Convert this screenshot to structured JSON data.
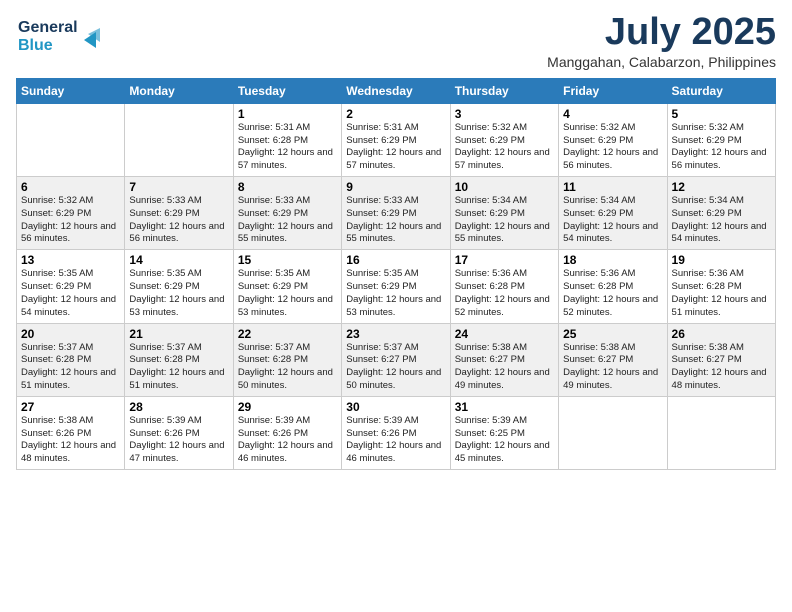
{
  "logo": {
    "line1": "General",
    "line2": "Blue"
  },
  "header": {
    "title": "July 2025",
    "subtitle": "Manggahan, Calabarzon, Philippines"
  },
  "days_of_week": [
    "Sunday",
    "Monday",
    "Tuesday",
    "Wednesday",
    "Thursday",
    "Friday",
    "Saturday"
  ],
  "weeks": [
    [
      {
        "day": "",
        "info": ""
      },
      {
        "day": "",
        "info": ""
      },
      {
        "day": "1",
        "info": "Sunrise: 5:31 AM\nSunset: 6:28 PM\nDaylight: 12 hours and 57 minutes."
      },
      {
        "day": "2",
        "info": "Sunrise: 5:31 AM\nSunset: 6:29 PM\nDaylight: 12 hours and 57 minutes."
      },
      {
        "day": "3",
        "info": "Sunrise: 5:32 AM\nSunset: 6:29 PM\nDaylight: 12 hours and 57 minutes."
      },
      {
        "day": "4",
        "info": "Sunrise: 5:32 AM\nSunset: 6:29 PM\nDaylight: 12 hours and 56 minutes."
      },
      {
        "day": "5",
        "info": "Sunrise: 5:32 AM\nSunset: 6:29 PM\nDaylight: 12 hours and 56 minutes."
      }
    ],
    [
      {
        "day": "6",
        "info": "Sunrise: 5:32 AM\nSunset: 6:29 PM\nDaylight: 12 hours and 56 minutes."
      },
      {
        "day": "7",
        "info": "Sunrise: 5:33 AM\nSunset: 6:29 PM\nDaylight: 12 hours and 56 minutes."
      },
      {
        "day": "8",
        "info": "Sunrise: 5:33 AM\nSunset: 6:29 PM\nDaylight: 12 hours and 55 minutes."
      },
      {
        "day": "9",
        "info": "Sunrise: 5:33 AM\nSunset: 6:29 PM\nDaylight: 12 hours and 55 minutes."
      },
      {
        "day": "10",
        "info": "Sunrise: 5:34 AM\nSunset: 6:29 PM\nDaylight: 12 hours and 55 minutes."
      },
      {
        "day": "11",
        "info": "Sunrise: 5:34 AM\nSunset: 6:29 PM\nDaylight: 12 hours and 54 minutes."
      },
      {
        "day": "12",
        "info": "Sunrise: 5:34 AM\nSunset: 6:29 PM\nDaylight: 12 hours and 54 minutes."
      }
    ],
    [
      {
        "day": "13",
        "info": "Sunrise: 5:35 AM\nSunset: 6:29 PM\nDaylight: 12 hours and 54 minutes."
      },
      {
        "day": "14",
        "info": "Sunrise: 5:35 AM\nSunset: 6:29 PM\nDaylight: 12 hours and 53 minutes."
      },
      {
        "day": "15",
        "info": "Sunrise: 5:35 AM\nSunset: 6:29 PM\nDaylight: 12 hours and 53 minutes."
      },
      {
        "day": "16",
        "info": "Sunrise: 5:35 AM\nSunset: 6:29 PM\nDaylight: 12 hours and 53 minutes."
      },
      {
        "day": "17",
        "info": "Sunrise: 5:36 AM\nSunset: 6:28 PM\nDaylight: 12 hours and 52 minutes."
      },
      {
        "day": "18",
        "info": "Sunrise: 5:36 AM\nSunset: 6:28 PM\nDaylight: 12 hours and 52 minutes."
      },
      {
        "day": "19",
        "info": "Sunrise: 5:36 AM\nSunset: 6:28 PM\nDaylight: 12 hours and 51 minutes."
      }
    ],
    [
      {
        "day": "20",
        "info": "Sunrise: 5:37 AM\nSunset: 6:28 PM\nDaylight: 12 hours and 51 minutes."
      },
      {
        "day": "21",
        "info": "Sunrise: 5:37 AM\nSunset: 6:28 PM\nDaylight: 12 hours and 51 minutes."
      },
      {
        "day": "22",
        "info": "Sunrise: 5:37 AM\nSunset: 6:28 PM\nDaylight: 12 hours and 50 minutes."
      },
      {
        "day": "23",
        "info": "Sunrise: 5:37 AM\nSunset: 6:27 PM\nDaylight: 12 hours and 50 minutes."
      },
      {
        "day": "24",
        "info": "Sunrise: 5:38 AM\nSunset: 6:27 PM\nDaylight: 12 hours and 49 minutes."
      },
      {
        "day": "25",
        "info": "Sunrise: 5:38 AM\nSunset: 6:27 PM\nDaylight: 12 hours and 49 minutes."
      },
      {
        "day": "26",
        "info": "Sunrise: 5:38 AM\nSunset: 6:27 PM\nDaylight: 12 hours and 48 minutes."
      }
    ],
    [
      {
        "day": "27",
        "info": "Sunrise: 5:38 AM\nSunset: 6:26 PM\nDaylight: 12 hours and 48 minutes."
      },
      {
        "day": "28",
        "info": "Sunrise: 5:39 AM\nSunset: 6:26 PM\nDaylight: 12 hours and 47 minutes."
      },
      {
        "day": "29",
        "info": "Sunrise: 5:39 AM\nSunset: 6:26 PM\nDaylight: 12 hours and 46 minutes."
      },
      {
        "day": "30",
        "info": "Sunrise: 5:39 AM\nSunset: 6:26 PM\nDaylight: 12 hours and 46 minutes."
      },
      {
        "day": "31",
        "info": "Sunrise: 5:39 AM\nSunset: 6:25 PM\nDaylight: 12 hours and 45 minutes."
      },
      {
        "day": "",
        "info": ""
      },
      {
        "day": "",
        "info": ""
      }
    ]
  ]
}
